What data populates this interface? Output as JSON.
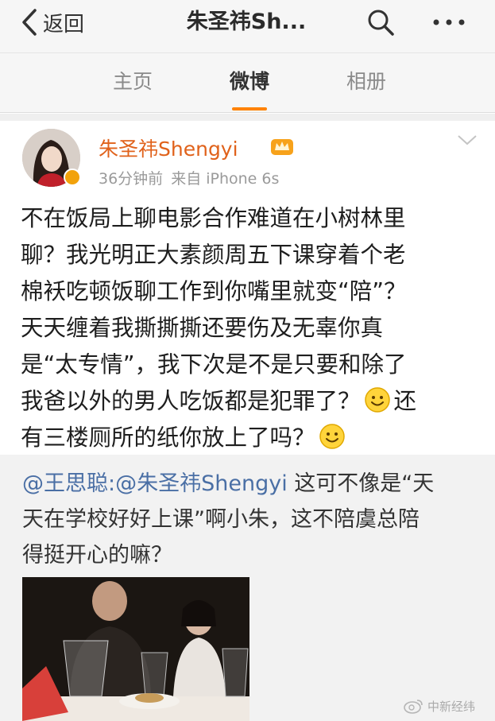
{
  "nav": {
    "back_label": "返回",
    "title": "朱圣祎Sh..."
  },
  "tabs": [
    {
      "label": "主页"
    },
    {
      "label": "微博"
    },
    {
      "label": "相册"
    }
  ],
  "active_tab": "微博",
  "accent_color": "#ff8200",
  "post": {
    "author": "朱圣祎Shengyi",
    "time": "36分钟前",
    "source": "来自 iPhone 6s",
    "lines": [
      "不在饭局上聊电影合作难道在小树林里",
      "聊？我光明正大素颜周五下课穿着个老",
      "棉袄吃顿饭聊工作到你嘴里就变“陪”？",
      "天天缠着我撕撕撕还要伤及无辜你真",
      "是“太专情”，我下次是不是只要和除了",
      "我爸以外的男人吃饭都是犯罪了？",
      "还",
      "有三楼厕所的纸你放上了吗？"
    ]
  },
  "repost": {
    "mention_prefix": "@王思聪:@朱圣祎Shengyi",
    "line1_rest": " 这可不像是“天",
    "line2": "天在学校好好上课”啊小朱，这不陪虞总陪",
    "line3": "得挺开心的嘛？"
  },
  "watermark": "中新经纬",
  "icons": [
    "chevron-left-icon",
    "search-icon",
    "more-dots-icon",
    "chevron-down-icon",
    "crown-badge-icon",
    "verified-badge-icon",
    "smile-emoji-icon",
    "weibo-logo-icon"
  ]
}
